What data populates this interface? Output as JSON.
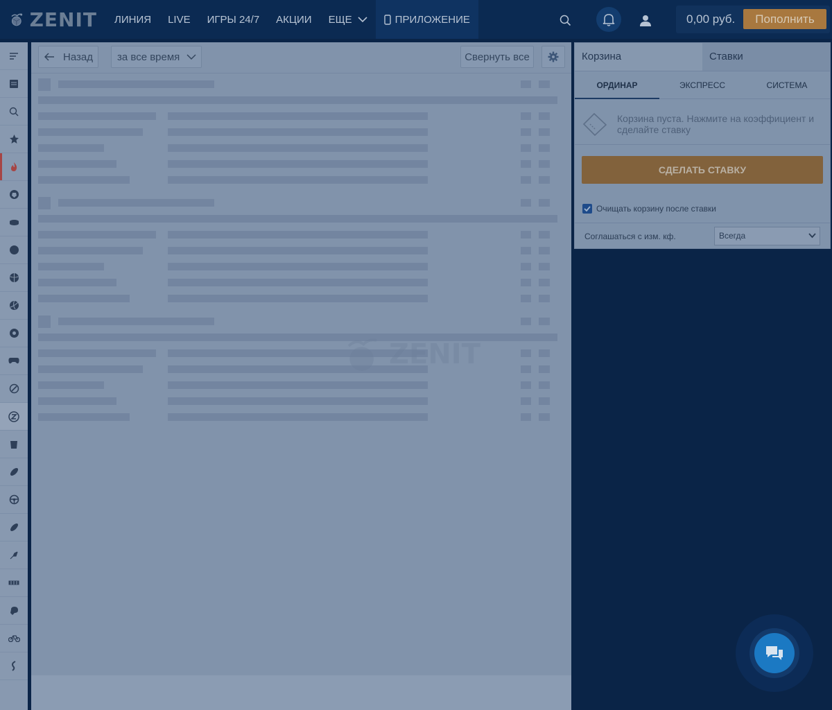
{
  "header": {
    "logo_text": "ZENIT",
    "nav": [
      {
        "label": "ЛИНИЯ"
      },
      {
        "label": "LIVE"
      },
      {
        "label": "ИГРЫ 24/7"
      },
      {
        "label": "АКЦИИ"
      },
      {
        "label": "ЕЩЕ"
      },
      {
        "label": "ПРИЛОЖЕНИЕ"
      }
    ],
    "balance": "0,00 руб.",
    "topup_label": "Пополнить",
    "icons": [
      "search-icon",
      "bell-icon",
      "user-icon"
    ]
  },
  "sidebar": {
    "items": [
      {
        "icon": "menu-lines-icon"
      },
      {
        "icon": "calendar-icon"
      },
      {
        "icon": "search-icon"
      },
      {
        "icon": "star-icon"
      },
      {
        "icon": "fire-icon"
      },
      {
        "icon": "soccer-ball-icon"
      },
      {
        "icon": "hockey-puck-icon"
      },
      {
        "icon": "basketball-icon"
      },
      {
        "icon": "tennis-ball-icon"
      },
      {
        "icon": "volleyball-icon"
      },
      {
        "icon": "handball-icon"
      },
      {
        "icon": "gamepad-icon"
      },
      {
        "icon": "baseball-icon"
      },
      {
        "icon": "zenit-z-icon"
      },
      {
        "icon": "bucket-icon"
      },
      {
        "icon": "rugby-ball-icon"
      },
      {
        "icon": "steering-wheel-icon"
      },
      {
        "icon": "american-football-icon"
      },
      {
        "icon": "badminton-icon"
      },
      {
        "icon": "ticket-strip-icon"
      },
      {
        "icon": "boxing-glove-icon"
      },
      {
        "icon": "bicycle-icon"
      },
      {
        "icon": "more-sports-icon"
      }
    ]
  },
  "toolbar": {
    "back_label": "Назад",
    "period_value": "за все время",
    "collapse_label": "Свернуть все"
  },
  "betslip": {
    "tabs": [
      {
        "label": "Корзина"
      },
      {
        "label": "Ставки"
      }
    ],
    "types": [
      {
        "label": "ОРДИНАР"
      },
      {
        "label": "ЭКСПРЕСС"
      },
      {
        "label": "СИСТЕМА"
      }
    ],
    "empty_message": "Корзина пуста. Нажмите на коэффициент и сделайте ставку",
    "make_bet_label": "СДЕЛАТЬ СТАВКУ",
    "clear_after_label": "Очищать корзину после ставки",
    "clear_after_checked": true,
    "accept_label": "Соглашаться с изм. кф.",
    "accept_value": "Всегда"
  },
  "colors": {
    "accent_orange": "#a8783f",
    "header_bg": "#0b2a52",
    "chat_blue": "#1b79c3",
    "live_marker": "#a64545"
  }
}
